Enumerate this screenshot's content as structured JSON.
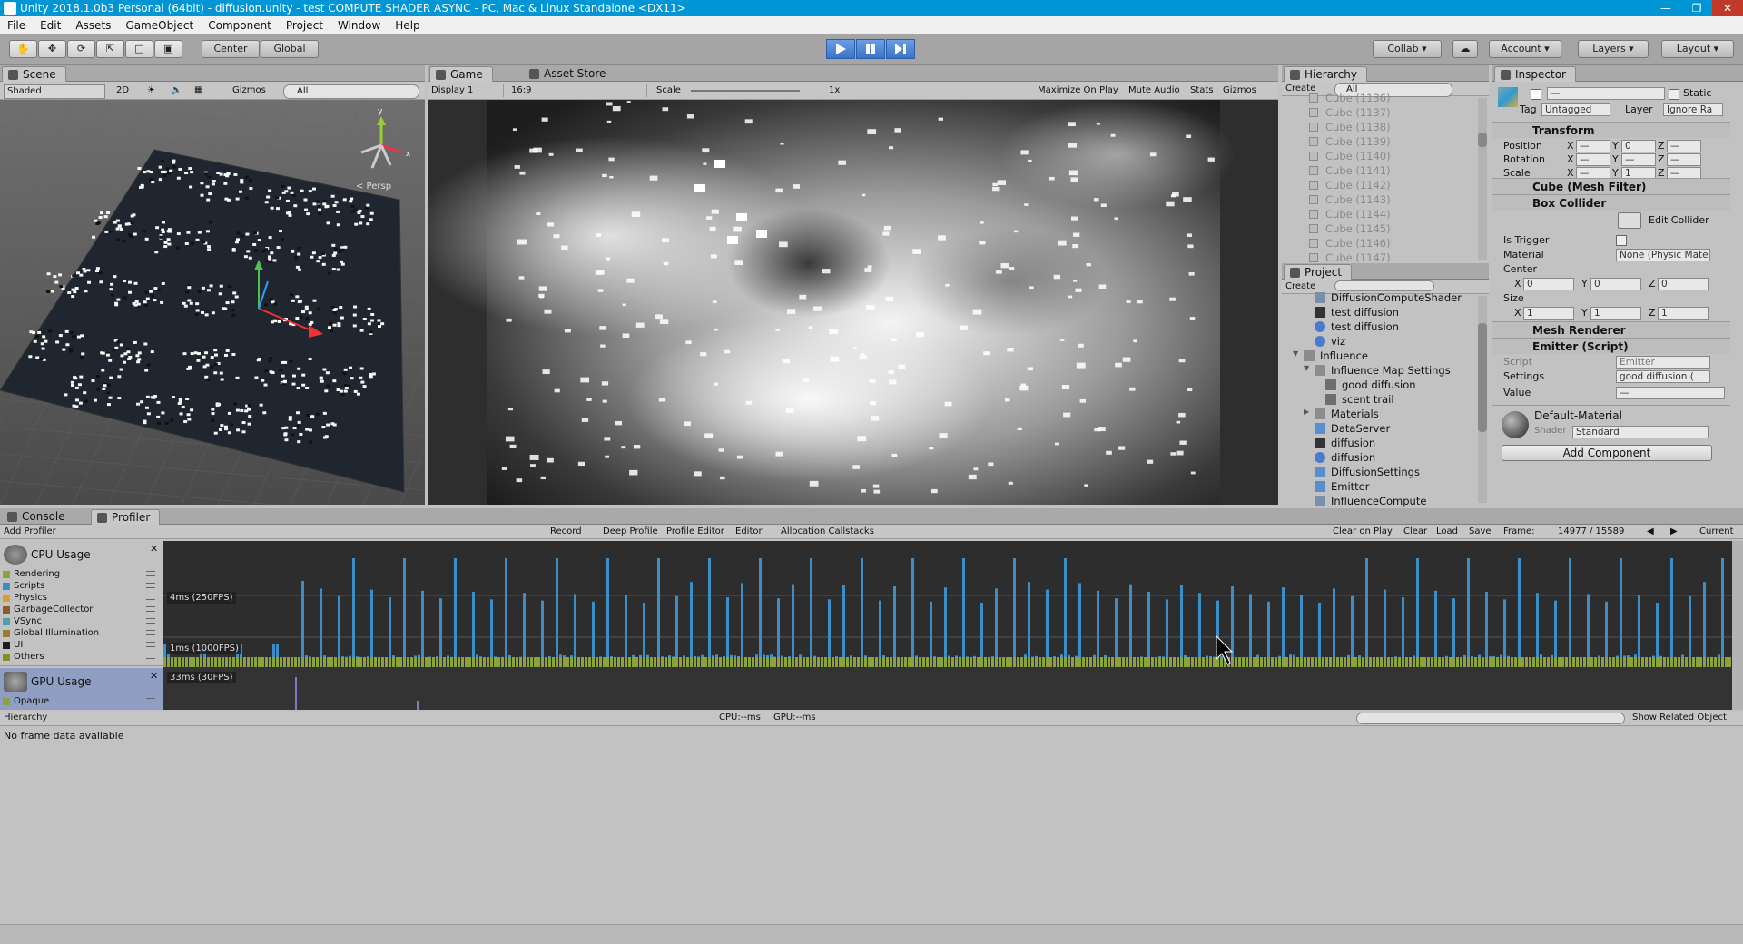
{
  "window": {
    "title": "Unity 2018.1.0b3 Personal (64bit) - diffusion.unity - test COMPUTE SHADER ASYNC - PC, Mac & Linux Standalone <DX11>"
  },
  "menu": [
    "File",
    "Edit",
    "Assets",
    "GameObject",
    "Component",
    "Project",
    "Window",
    "Help"
  ],
  "toolbar": {
    "center": "Center",
    "global": "Global",
    "collab": "Collab",
    "account": "Account",
    "layers": "Layers",
    "layout": "Layout"
  },
  "scene": {
    "tab": "Scene",
    "shading": "Shaded",
    "mode2d": "2D",
    "gizmos": "Gizmos",
    "search": "All",
    "persp": "< Persp"
  },
  "game": {
    "tab": "Game",
    "asset_store": "Asset Store",
    "display": "Display 1",
    "aspect": "16:9",
    "scale_label": "Scale",
    "scale_value": "1x",
    "maximize": "Maximize On Play",
    "mute": "Mute Audio",
    "stats": "Stats",
    "gizmos": "Gizmos"
  },
  "hierarchy": {
    "tab": "Hierarchy",
    "create": "Create",
    "search": "All",
    "items": [
      "Cube (1136)",
      "Cube (1137)",
      "Cube (1138)",
      "Cube (1139)",
      "Cube (1140)",
      "Cube (1141)",
      "Cube (1142)",
      "Cube (1143)",
      "Cube (1144)",
      "Cube (1145)",
      "Cube (1146)",
      "Cube (1147)"
    ]
  },
  "project": {
    "tab": "Project",
    "create": "Create",
    "items": [
      {
        "label": "DiffusionComputeShader",
        "indent": 1,
        "icon": "shader"
      },
      {
        "label": "test diffusion",
        "indent": 1,
        "icon": "unity"
      },
      {
        "label": "test diffusion",
        "indent": 1,
        "icon": "prefab"
      },
      {
        "label": "viz",
        "indent": 1,
        "icon": "sphere"
      },
      {
        "label": "Influence",
        "indent": 0,
        "icon": "folder",
        "arrow": "▼"
      },
      {
        "label": "Influence Map Settings",
        "indent": 1,
        "icon": "folder",
        "arrow": "▼"
      },
      {
        "label": "good diffusion",
        "indent": 2,
        "icon": "asset"
      },
      {
        "label": "scent trail",
        "indent": 2,
        "icon": "asset"
      },
      {
        "label": "Materials",
        "indent": 1,
        "icon": "folder",
        "arrow": "▶"
      },
      {
        "label": "DataServer",
        "indent": 1,
        "icon": "script"
      },
      {
        "label": "diffusion",
        "indent": 1,
        "icon": "unity"
      },
      {
        "label": "diffusion",
        "indent": 1,
        "icon": "prefab"
      },
      {
        "label": "DiffusionSettings",
        "indent": 1,
        "icon": "script"
      },
      {
        "label": "Emitter",
        "indent": 1,
        "icon": "script"
      },
      {
        "label": "InfluenceCompute",
        "indent": 1,
        "icon": "shader"
      }
    ]
  },
  "inspector": {
    "tab": "Inspector",
    "name": "—",
    "static": "Static",
    "tag_label": "Tag",
    "tag": "Untagged",
    "layer_label": "Layer",
    "layer": "Ignore Ra",
    "transform": {
      "title": "Transform",
      "position": "Position",
      "rotation": "Rotation",
      "scale": "Scale",
      "x": "X",
      "y": "Y",
      "z": "Z",
      "pos": [
        "—",
        "0",
        "—"
      ],
      "rot": [
        "—",
        "—",
        "—"
      ],
      "scl": [
        "—",
        "1",
        "—"
      ]
    },
    "mesh_filter": "Cube (Mesh Filter)",
    "box_collider": {
      "title": "Box Collider",
      "edit": "Edit Collider",
      "is_trigger": "Is Trigger",
      "material_label": "Material",
      "material": "None (Physic Mate",
      "center": "Center",
      "size": "Size",
      "cx": "0",
      "cy": "0",
      "cz": "0",
      "sx": "1",
      "sy": "1",
      "sz": "1"
    },
    "mesh_renderer": "Mesh Renderer",
    "emitter": {
      "title": "Emitter (Script)",
      "script_label": "Script",
      "script": "Emitter",
      "settings_label": "Settings",
      "settings": "good diffusion (",
      "value_label": "Value",
      "value": "—"
    },
    "material": {
      "name": "Default-Material",
      "shader_label": "Shader",
      "shader": "Standard"
    },
    "add_component": "Add Component"
  },
  "console": {
    "tab": "Console"
  },
  "profiler": {
    "tab": "Profiler",
    "add": "Add Profiler",
    "record": "Record",
    "deep": "Deep Profile",
    "editor_prof": "Profile Editor",
    "editor": "Editor",
    "alloc": "Allocation Callstacks",
    "clear_on_play": "Clear on Play",
    "clear": "Clear",
    "load": "Load",
    "save": "Save",
    "frame_label": "Frame:",
    "frame": "14977 / 15589",
    "current": "Current",
    "cpu_title": "CPU Usage",
    "gpu_title": "GPU Usage",
    "cpu_legend": [
      {
        "name": "Rendering",
        "color": "#8aa33a"
      },
      {
        "name": "Scripts",
        "color": "#3c8ec9"
      },
      {
        "name": "Physics",
        "color": "#d6a028"
      },
      {
        "name": "GarbageCollector",
        "color": "#8e5a2c"
      },
      {
        "name": "VSync",
        "color": "#4fa0a8"
      },
      {
        "name": "Global Illumination",
        "color": "#9a7b30"
      },
      {
        "name": "UI",
        "color": "#1c1c1c"
      },
      {
        "name": "Others",
        "color": "#8c8c2c"
      }
    ],
    "gpu_legend": [
      {
        "name": "Opaque",
        "color": "#8aa33a"
      }
    ],
    "cpu_label_high": "4ms (250FPS)",
    "cpu_label_low": "1ms (1000FPS)",
    "gpu_label": "33ms (30FPS)",
    "hierarchy": "Hierarchy",
    "cpu_time": "CPU:--ms",
    "gpu_time": "GPU:--ms",
    "show_related": "Show Related Object",
    "no_data": "No frame data available"
  }
}
